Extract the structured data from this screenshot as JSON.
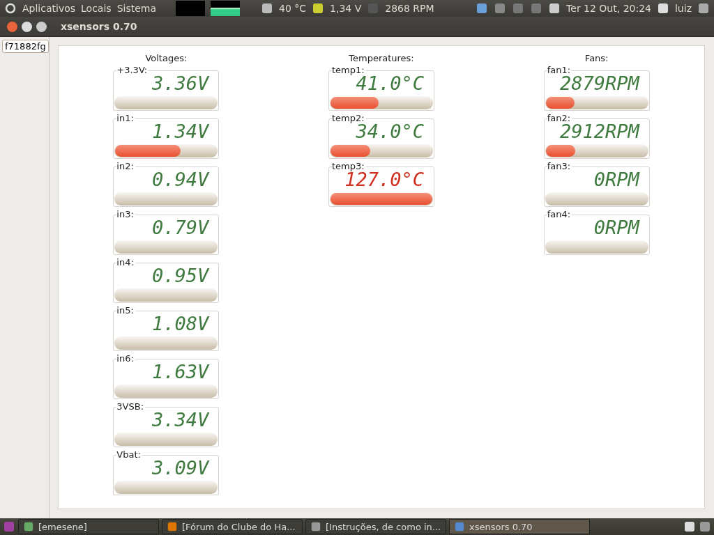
{
  "top_panel": {
    "menus": [
      "Aplicativos",
      "Locais",
      "Sistema"
    ],
    "indicators": [
      "40 °C",
      "1,34 V",
      "2868 RPM"
    ],
    "clock": "Ter 12 Out, 20:24",
    "user": "luiz"
  },
  "window": {
    "title": "xsensors 0.70"
  },
  "tabs": [
    {
      "label": "f71882fg",
      "selected": true
    }
  ],
  "groups": [
    {
      "title": "Voltages:",
      "sensors": [
        {
          "label": "+3.3V:",
          "reading": "3.36V",
          "alarm": false
        },
        {
          "label": "in1:",
          "reading": "1.34V",
          "level": 0.64,
          "alarm": false
        },
        {
          "label": "in2:",
          "reading": "0.94V",
          "alarm": false
        },
        {
          "label": "in3:",
          "reading": "0.79V",
          "alarm": false
        },
        {
          "label": "in4:",
          "reading": "0.95V",
          "alarm": false
        },
        {
          "label": "in5:",
          "reading": "1.08V",
          "alarm": false
        },
        {
          "label": "in6:",
          "reading": "1.63V",
          "alarm": false
        },
        {
          "label": "3VSB:",
          "reading": "3.34V",
          "alarm": false
        },
        {
          "label": "Vbat:",
          "reading": "3.09V",
          "alarm": false
        }
      ]
    },
    {
      "title": "Temperatures:",
      "sensors": [
        {
          "label": "temp1:",
          "reading": "41.0°C",
          "level": 0.47,
          "alarm": false
        },
        {
          "label": "temp2:",
          "reading": "34.0°C",
          "level": 0.39,
          "alarm": false
        },
        {
          "label": "temp3:",
          "reading": "127.0°C",
          "level": 1,
          "alarm": true
        }
      ]
    },
    {
      "title": "Fans:",
      "sensors": [
        {
          "label": "fan1:",
          "reading": "2879RPM",
          "level": 0.28,
          "alarm": false
        },
        {
          "label": "fan2:",
          "reading": "2912RPM",
          "level": 0.29,
          "alarm": false
        },
        {
          "label": "fan3:",
          "reading": "0RPM",
          "alarm": false
        },
        {
          "label": "fan4:",
          "reading": "0RPM",
          "alarm": false
        }
      ]
    }
  ],
  "taskbar": [
    {
      "label": "[emesene]",
      "selected": false
    },
    {
      "label": "[Fórum do Clube do Ha...",
      "selected": false
    },
    {
      "label": "[Instruções, de como in...",
      "selected": false
    },
    {
      "label": "xsensors 0.70",
      "selected": true
    }
  ]
}
